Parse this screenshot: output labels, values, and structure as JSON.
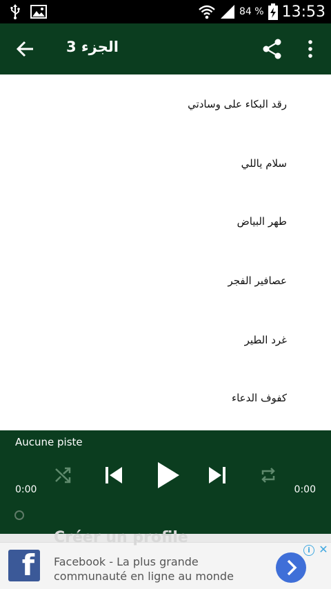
{
  "status_bar": {
    "battery_text": "84 %",
    "time": "13:53",
    "icons": [
      "usb-icon",
      "image-icon",
      "wifi-icon",
      "signal-icon",
      "battery-charging-icon"
    ]
  },
  "app_bar": {
    "title": "الجزء 3",
    "icons": [
      "back-arrow-icon",
      "share-icon",
      "more-vert-icon"
    ]
  },
  "list": {
    "items": [
      "رقد البكاء على وسادتي",
      "سلام ياللي",
      "طهر البياض",
      "عصافير الفجر",
      "غرد الطير",
      "كفوف الدعاء"
    ]
  },
  "player": {
    "track": "Aucune piste",
    "time_current": "0:00",
    "time_total": "0:00",
    "progress": 0,
    "icons": [
      "shuffle-icon",
      "previous-icon",
      "play-icon",
      "next-icon",
      "repeat-icon"
    ]
  },
  "ad": {
    "background_text": "Créer un profile",
    "line1": "Facebook - La plus grande",
    "line2": "communauté en ligne au monde",
    "logo_letter": "f",
    "info": "i",
    "close": "✕",
    "colors": {
      "facebook_blue": "#3b5998",
      "button_blue": "#3f6fd8",
      "adchoices_blue": "#43a9e0"
    }
  },
  "colors": {
    "primary": "#0b3d1f",
    "status_bar": "#000000"
  }
}
